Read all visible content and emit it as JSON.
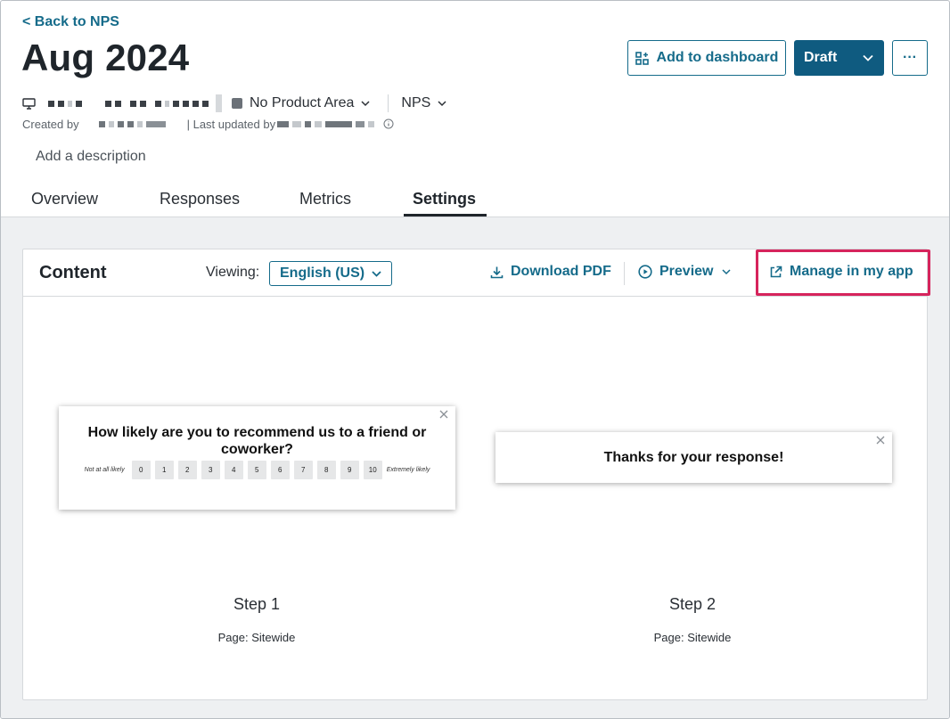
{
  "header": {
    "back_link": "< Back to NPS",
    "title": "Aug 2024",
    "add_to_dashboard": "Add to dashboard",
    "status_button": "Draft",
    "more_button": "···"
  },
  "meta": {
    "product_area": "No Product Area",
    "type": "NPS",
    "created_by_label": "Created by",
    "last_updated_label": "| Last updated by"
  },
  "description_placeholder": "Add a description",
  "tabs": [
    {
      "label": "Overview"
    },
    {
      "label": "Responses"
    },
    {
      "label": "Metrics"
    },
    {
      "label": "Settings"
    }
  ],
  "content": {
    "title": "Content",
    "viewing_label": "Viewing:",
    "language": "English (US)",
    "download_pdf": "Download PDF",
    "preview": "Preview",
    "manage_app": "Manage in my app"
  },
  "steps": [
    {
      "question": "How likely are you to recommend us to a friend or coworker?",
      "scale_low": "Not at all likely",
      "scale_high": "Extremely likely",
      "scale": [
        "0",
        "1",
        "2",
        "3",
        "4",
        "5",
        "6",
        "7",
        "8",
        "9",
        "10"
      ],
      "title": "Step 1",
      "page": "Page: Sitewide"
    },
    {
      "message": "Thanks for your response!",
      "title": "Step 2",
      "page": "Page: Sitewide"
    }
  ],
  "colors": {
    "accent": "#156b8a",
    "primary_button": "#0f5b80",
    "highlight": "#d6245c"
  }
}
